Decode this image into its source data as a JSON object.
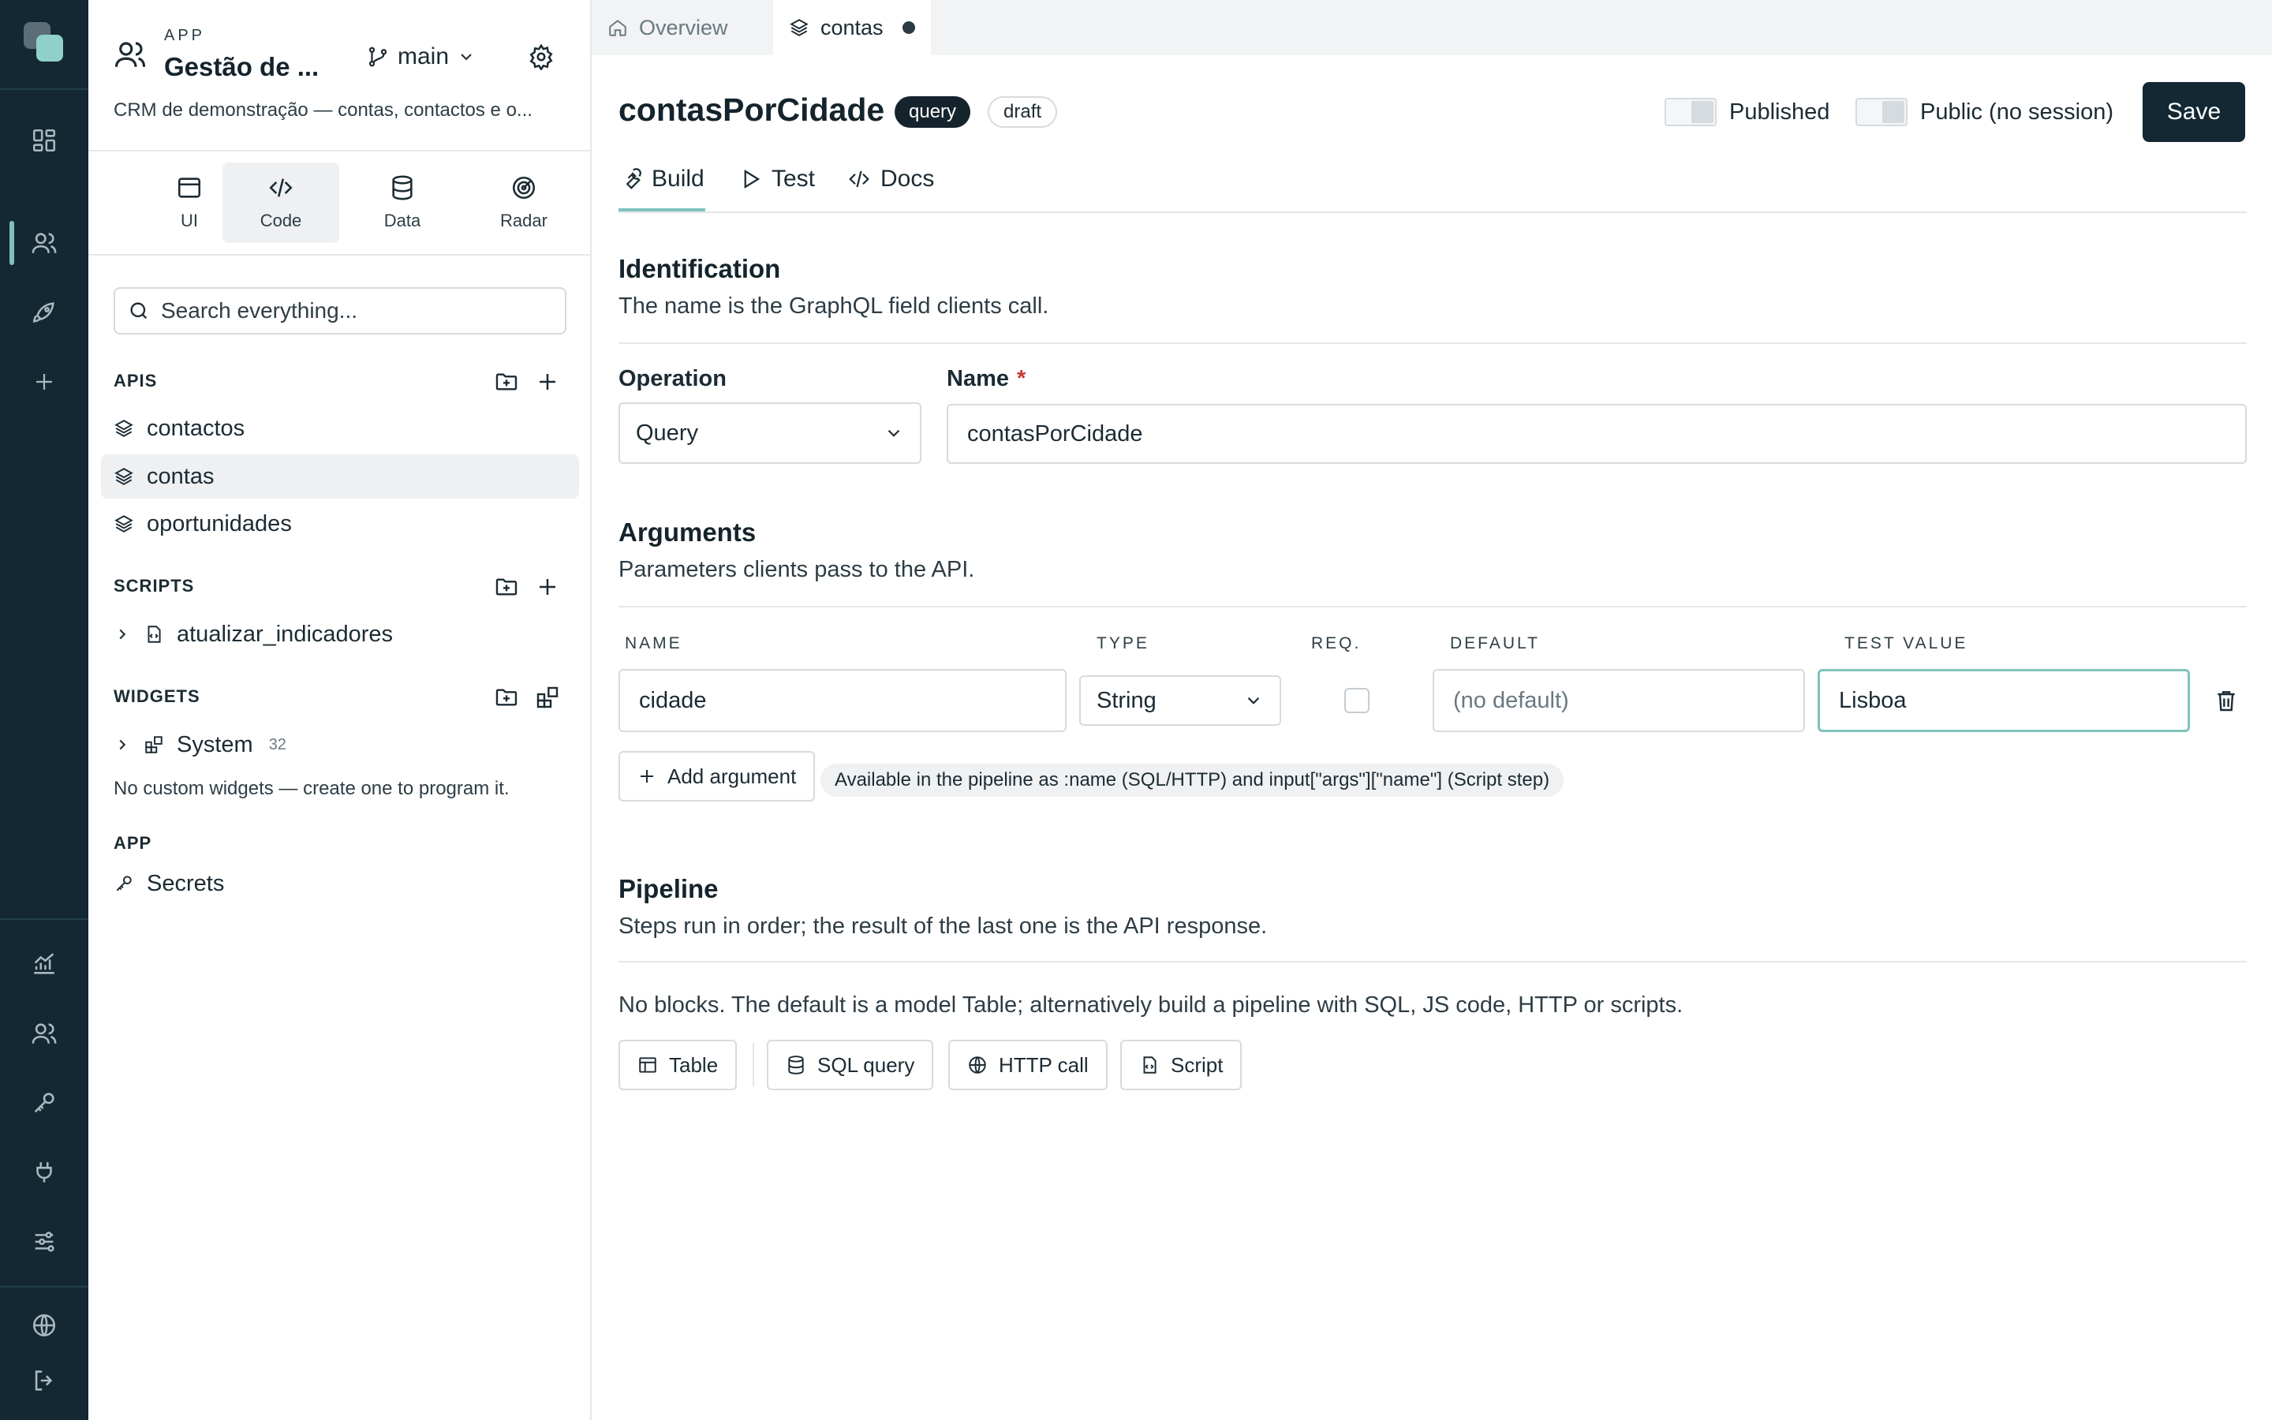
{
  "sidebar": {
    "app_kicker": "APP",
    "app_name": "Gestão de ...",
    "app_description": "CRM de demonstração — contas, contactos e o...",
    "branch": "main",
    "modes": [
      {
        "label": "UI",
        "icon": "window-icon"
      },
      {
        "label": "Code",
        "icon": "code-icon",
        "active": true
      },
      {
        "label": "Data",
        "icon": "database-icon"
      },
      {
        "label": "Radar",
        "icon": "radar-icon"
      }
    ],
    "search_placeholder": "Search everything...",
    "sections": {
      "apis": {
        "title": "APIS",
        "items": [
          "contactos",
          "contas",
          "oportunidades"
        ],
        "active": "contas"
      },
      "scripts": {
        "title": "SCRIPTS",
        "items": [
          "atualizar_indicadores"
        ]
      },
      "widgets": {
        "title": "WIDGETS",
        "group": "System",
        "group_count": "32",
        "empty_note": "No custom widgets — create one to program it."
      },
      "app": {
        "title": "APP",
        "items": [
          "Secrets"
        ]
      }
    }
  },
  "tabs": [
    {
      "label": "Overview",
      "icon": "home-icon"
    },
    {
      "label": "contas",
      "icon": "layers-icon",
      "active": true,
      "dirty": true
    }
  ],
  "header": {
    "title": "contasPorCidade",
    "badges": [
      "query",
      "draft"
    ],
    "toggles": [
      {
        "label": "Published",
        "on": false
      },
      {
        "label": "Public (no session)",
        "on": false
      }
    ],
    "save_label": "Save"
  },
  "subtabs": [
    {
      "label": "Build",
      "icon": "wrench-icon",
      "active": true
    },
    {
      "label": "Test",
      "icon": "play-icon"
    },
    {
      "label": "Docs",
      "icon": "code-icon"
    }
  ],
  "identification": {
    "title": "Identification",
    "subtitle": "The name is the GraphQL field clients call.",
    "operation_label": "Operation",
    "operation_value": "Query",
    "name_label": "Name",
    "name_required": "*",
    "name_value": "contasPorCidade"
  },
  "arguments": {
    "title": "Arguments",
    "subtitle": "Parameters clients pass to the API.",
    "columns": [
      "NAME",
      "TYPE",
      "REQ.",
      "DEFAULT",
      "TEST VALUE"
    ],
    "rows": [
      {
        "name": "cidade",
        "type": "String",
        "required": false,
        "default_placeholder": "(no default)",
        "test_value": "Lisboa"
      }
    ],
    "add_label": "Add argument",
    "hint": "Available in the pipeline as :name (SQL/HTTP) and input[\"args\"][\"name\"] (Script step)"
  },
  "pipeline": {
    "title": "Pipeline",
    "subtitle": "Steps run in order; the result of the last one is the API response.",
    "empty_text": "No blocks. The default is a model Table; alternatively build a pipeline with SQL, JS code, HTTP or scripts.",
    "blocks": [
      {
        "label": "Table",
        "icon": "table-icon"
      },
      {
        "label": "SQL query",
        "icon": "database-icon"
      },
      {
        "label": "HTTP call",
        "icon": "globe-icon"
      },
      {
        "label": "Script",
        "icon": "script-icon"
      }
    ]
  },
  "colors": {
    "rail_bg": "#132833",
    "accent": "#7fc2bd",
    "primary_button": "#132833",
    "required": "#c93535"
  }
}
